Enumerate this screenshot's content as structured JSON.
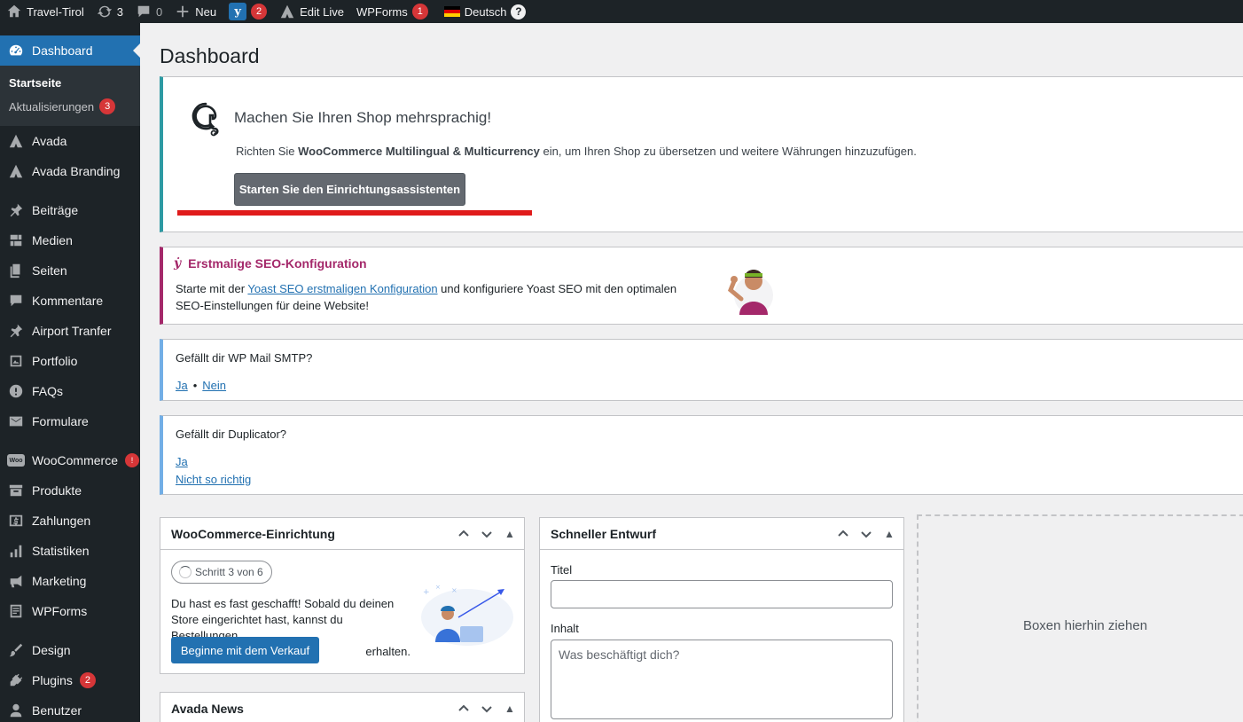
{
  "adminbar": {
    "site_name": "Travel-Tirol",
    "updates_count": "3",
    "comments_count": "0",
    "new_label": "Neu",
    "yoast_badge": "2",
    "edit_live_label": "Edit Live",
    "wpforms_label": "WPForms",
    "wpforms_badge": "1",
    "language_label": "Deutsch",
    "help_glyph": "?"
  },
  "sidebar": {
    "dashboard": "Dashboard",
    "sub_home": "Startseite",
    "sub_updates": "Aktualisierungen",
    "sub_updates_badge": "3",
    "items": {
      "avada": "Avada",
      "avada_branding": "Avada Branding",
      "posts": "Beiträge",
      "media": "Medien",
      "pages": "Seiten",
      "comments": "Kommentare",
      "airport": "Airport Tranfer",
      "portfolio": "Portfolio",
      "faqs": "FAQs",
      "forms": "Formulare",
      "woocommerce": "WooCommerce",
      "woocommerce_badge": "!",
      "products": "Produkte",
      "payments": "Zahlungen",
      "statistics": "Statistiken",
      "marketing": "Marketing",
      "wpforms": "WPForms",
      "design": "Design",
      "plugins": "Plugins",
      "plugins_badge": "2",
      "users": "Benutzer"
    },
    "woo_icon_text": "Woo"
  },
  "page": {
    "title": "Dashboard"
  },
  "notice_wpml": {
    "heading": "Machen Sie Ihren Shop mehrsprachig!",
    "desc_before": "Richten Sie ",
    "desc_bold": "WooCommerce Multilingual & Multicurrency",
    "desc_after": " ein, um Ihren Shop zu übersetzen und weitere Währungen hinzuzufügen.",
    "button": "Starten Sie den Einrichtungsassistenten"
  },
  "notice_yoast": {
    "heading": "Erstmalige SEO-Konfiguration",
    "text_before": "Starte mit der ",
    "link": "Yoast SEO erstmaligen Konfiguration",
    "text_after": " und konfiguriere Yoast SEO mit den optimalen SEO-Einstellungen für deine Website!"
  },
  "notice_smtp": {
    "question": "Gefällt dir WP Mail SMTP?",
    "yes": "Ja",
    "sep": "•",
    "no": "Nein"
  },
  "notice_duplicator": {
    "question": "Gefällt dir Duplicator?",
    "yes": "Ja",
    "no": "Nicht so richtig"
  },
  "woo_setup": {
    "title": "WooCommerce-Einrichtung",
    "step": "Schritt 3 von 6",
    "text_main": "Du hast es fast geschafft! Sobald du deinen Store eingerichtet hast, kannst du Bestellungen",
    "text_end": "erhalten.",
    "button": "Beginne mit dem Verkauf"
  },
  "quick_draft": {
    "title": "Schneller Entwurf",
    "title_label": "Titel",
    "title_value": "",
    "content_label": "Inhalt",
    "content_placeholder": "Was beschäftigt dich?"
  },
  "avada_news": {
    "title": "Avada News"
  },
  "dropzone": {
    "label": "Boxen hierhin ziehen"
  },
  "colors": {
    "adminbar_bg": "#1d2327",
    "accent": "#2271b1",
    "badge": "#d63638",
    "yoast": "#a4286a",
    "wpml_border": "#2d9aa3",
    "highlight_line": "#e01b1b"
  }
}
